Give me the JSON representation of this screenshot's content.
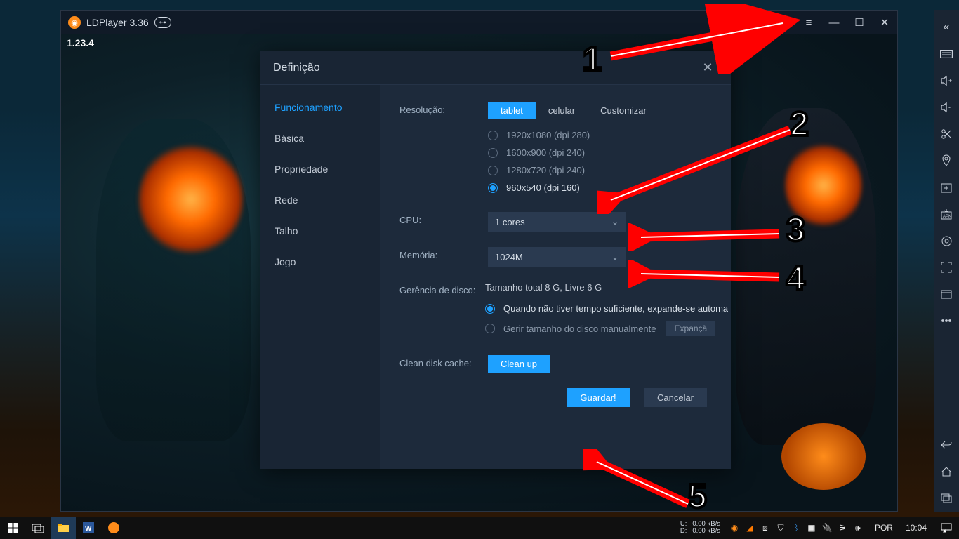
{
  "app": {
    "title": "LDPlayer 3.36",
    "game_version": "1.23.4"
  },
  "window_buttons": {
    "menu": "≡",
    "min": "—",
    "max": "☐",
    "close": "✕"
  },
  "sidebar_chevron": "«",
  "modal": {
    "title": "Definição",
    "nav": [
      "Funcionamento",
      "Básica",
      "Propriedade",
      "Rede",
      "Talho",
      "Jogo"
    ],
    "nav_active_index": 0,
    "labels": {
      "resolution": "Resolução:",
      "cpu": "CPU:",
      "memory": "Memória:",
      "disk": "Gerência de disco:",
      "clean": "Clean disk cache:"
    },
    "res_tabs": [
      "tablet",
      "celular",
      "Customizar"
    ],
    "res_tab_active": 0,
    "res_options": [
      {
        "label": "1920x1080  (dpi 280)",
        "checked": false
      },
      {
        "label": "1600x900  (dpi 240)",
        "checked": false
      },
      {
        "label": "1280x720  (dpi 240)",
        "checked": false
      },
      {
        "label": "960x540  (dpi 160)",
        "checked": true
      }
    ],
    "cpu_value": "1 cores",
    "mem_value": "1024M",
    "disk_info": "Tamanho total 8 G,  Livre 6 G",
    "disk_opts": [
      {
        "label": "Quando não tiver tempo suficiente, expande-se automaticamente",
        "checked": true
      },
      {
        "label": "Gerir tamanho do disco manualmente",
        "checked": false,
        "tail": "Expançã"
      }
    ],
    "clean_btn": "Clean up",
    "save_btn": "Guardar!",
    "cancel_btn": "Cancelar"
  },
  "annotations": {
    "n1": "1",
    "n2": "2",
    "n3": "3",
    "n4": "4",
    "n5": "5"
  },
  "taskbar": {
    "net_u": "U:",
    "net_d": "D:",
    "net_up": "0.00 kB/s",
    "net_down": "0.00 kB/s",
    "lang": "POR",
    "time": "10:04"
  }
}
